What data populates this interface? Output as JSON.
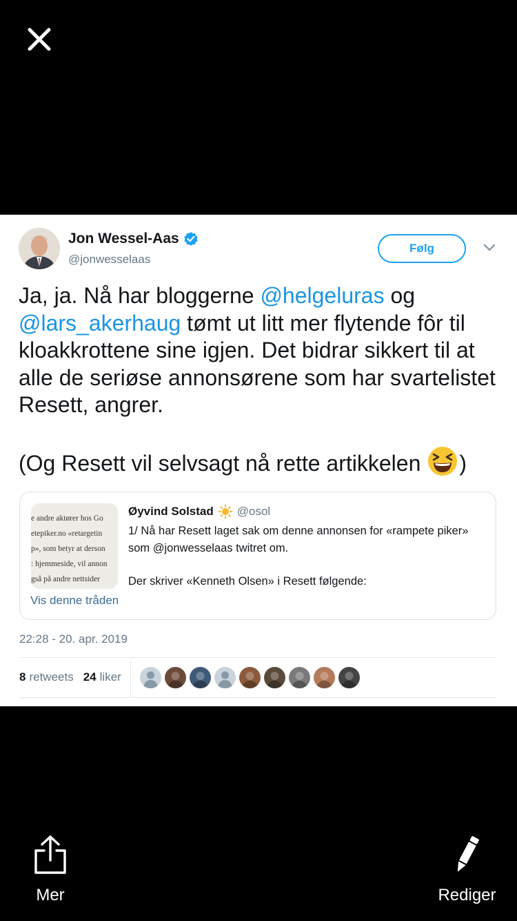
{
  "author": {
    "name": "Jon Wessel-Aas",
    "handle": "@jonwesselaas"
  },
  "follow_label": "Følg",
  "tweet": {
    "part1": "Ja, ja. Nå har bloggerne ",
    "mention1": "@helgeluras",
    "part2": " og ",
    "mention2": "@lars_akerhaug",
    "part3": " tømt ut litt mer flytende fôr til kloakkrottene sine igjen. Det bidrar sikkert til at alle de seriøse annonsørene som har svartelistet Resett, angrer.",
    "part4": "(Og Resett vil selvsagt nå rette artikkelen",
    "part5": ")"
  },
  "quote": {
    "name": "Øyvind Solstad",
    "handle": "@osol",
    "text_line1": "1/ Nå har Resett laget sak om denne annonsen for «rampete piker» som @jonwesselaas twitret om.",
    "text_line2": "Der skriver «Kenneth Olsen» i Resett følgende:",
    "thumb_lines": [
      "e andre aktører hos Go",
      "etepiker.no «retargetin",
      "p», som betyr at derson",
      ": hjemmeside, vil annon",
      "gså på andre nettsider"
    ],
    "thread_link": "Vis denne tråden"
  },
  "timestamp": "22:28 - 20. apr. 2019",
  "stats": {
    "retweets_count": "8",
    "retweets_label": "retweets",
    "likes_count": "24",
    "likes_label": "liker"
  },
  "likers": [
    "#c9d3dc",
    "#6b4a3a",
    "#3f5a78",
    "#c9d3dc",
    "#8a5a3a",
    "#5a4a3a",
    "#7a7a7a",
    "#b47a5a",
    "#444444"
  ],
  "bottom": {
    "share_label": "Mer",
    "edit_label": "Rediger"
  },
  "colors": {
    "accent": "#1da1f2",
    "mention": "#1b95e0",
    "verified": "#1da1f2"
  }
}
